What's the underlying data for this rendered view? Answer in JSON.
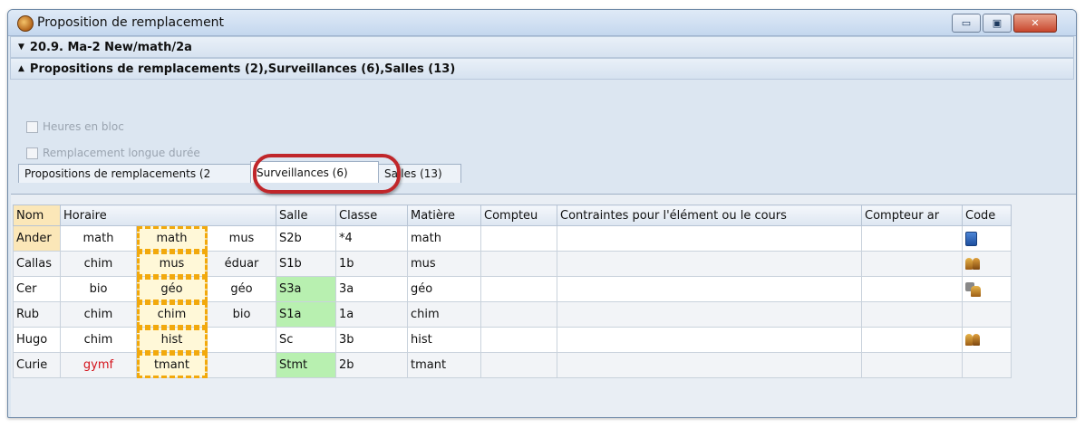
{
  "window": {
    "title": "Proposition de remplacement",
    "controls": {
      "minimize": "▭",
      "maximize": "▣",
      "close": "✕"
    }
  },
  "sections": [
    {
      "label": "20.9. Ma-2 New/math/2a",
      "expanded": false
    },
    {
      "label": "Propositions de remplacements (2),Surveillances (6),Salles (13)",
      "expanded": true
    }
  ],
  "options": {
    "heures_en_bloc": "Heures en bloc",
    "remplacement_longue_duree": "Remplacement longue durée"
  },
  "tabs": [
    {
      "label": "Propositions de remplacements (2",
      "active": false
    },
    {
      "label": "Surveillances (6)",
      "active": true
    },
    {
      "label": "Salles (13)",
      "active": false
    }
  ],
  "table": {
    "headers": [
      "Nom",
      "Horaire",
      "Salle",
      "Classe",
      "Matière",
      "Compteu",
      "Contraintes pour l'élément ou le cours",
      "Compteur ar",
      "Code"
    ],
    "rows": [
      {
        "nom": "Ander",
        "h1": "math",
        "h2": "math",
        "h3": "mus",
        "salle": "S2b",
        "classe": "*4",
        "matiere": "math",
        "code_icon": "book-icon"
      },
      {
        "nom": "Callas",
        "h1": "chim",
        "h2": "mus",
        "h3": "éduar",
        "salle": "S1b",
        "classe": "1b",
        "matiere": "mus",
        "code_icon": "people-icon"
      },
      {
        "nom": "Cer",
        "h1": "bio",
        "h2": "géo",
        "h3": "géo",
        "salle": "S3a",
        "classe": "3a",
        "matiere": "géo",
        "code_icon": "teacher-room-icon"
      },
      {
        "nom": "Rub",
        "h1": "chim",
        "h2": "chim",
        "h3": "bio",
        "salle": "S1a",
        "classe": "1a",
        "matiere": "chim",
        "code_icon": ""
      },
      {
        "nom": "Hugo",
        "h1": "chim",
        "h2": "hist",
        "h3": "",
        "salle": "Sc",
        "classe": "3b",
        "matiere": "hist",
        "code_icon": "people-icon"
      },
      {
        "nom": "Curie",
        "h1": "gymf",
        "h2": "tmant",
        "h3": "",
        "salle": "Stmt",
        "classe": "2b",
        "matiere": "tmant",
        "code_icon": ""
      }
    ]
  },
  "colors": {
    "selected_name": "#fbe7b8",
    "free_room": "#b8f0b0",
    "conflict_text": "#d4121a",
    "current_hour_outline": "#f2a90c",
    "annotation_ring": "#c0262a"
  }
}
